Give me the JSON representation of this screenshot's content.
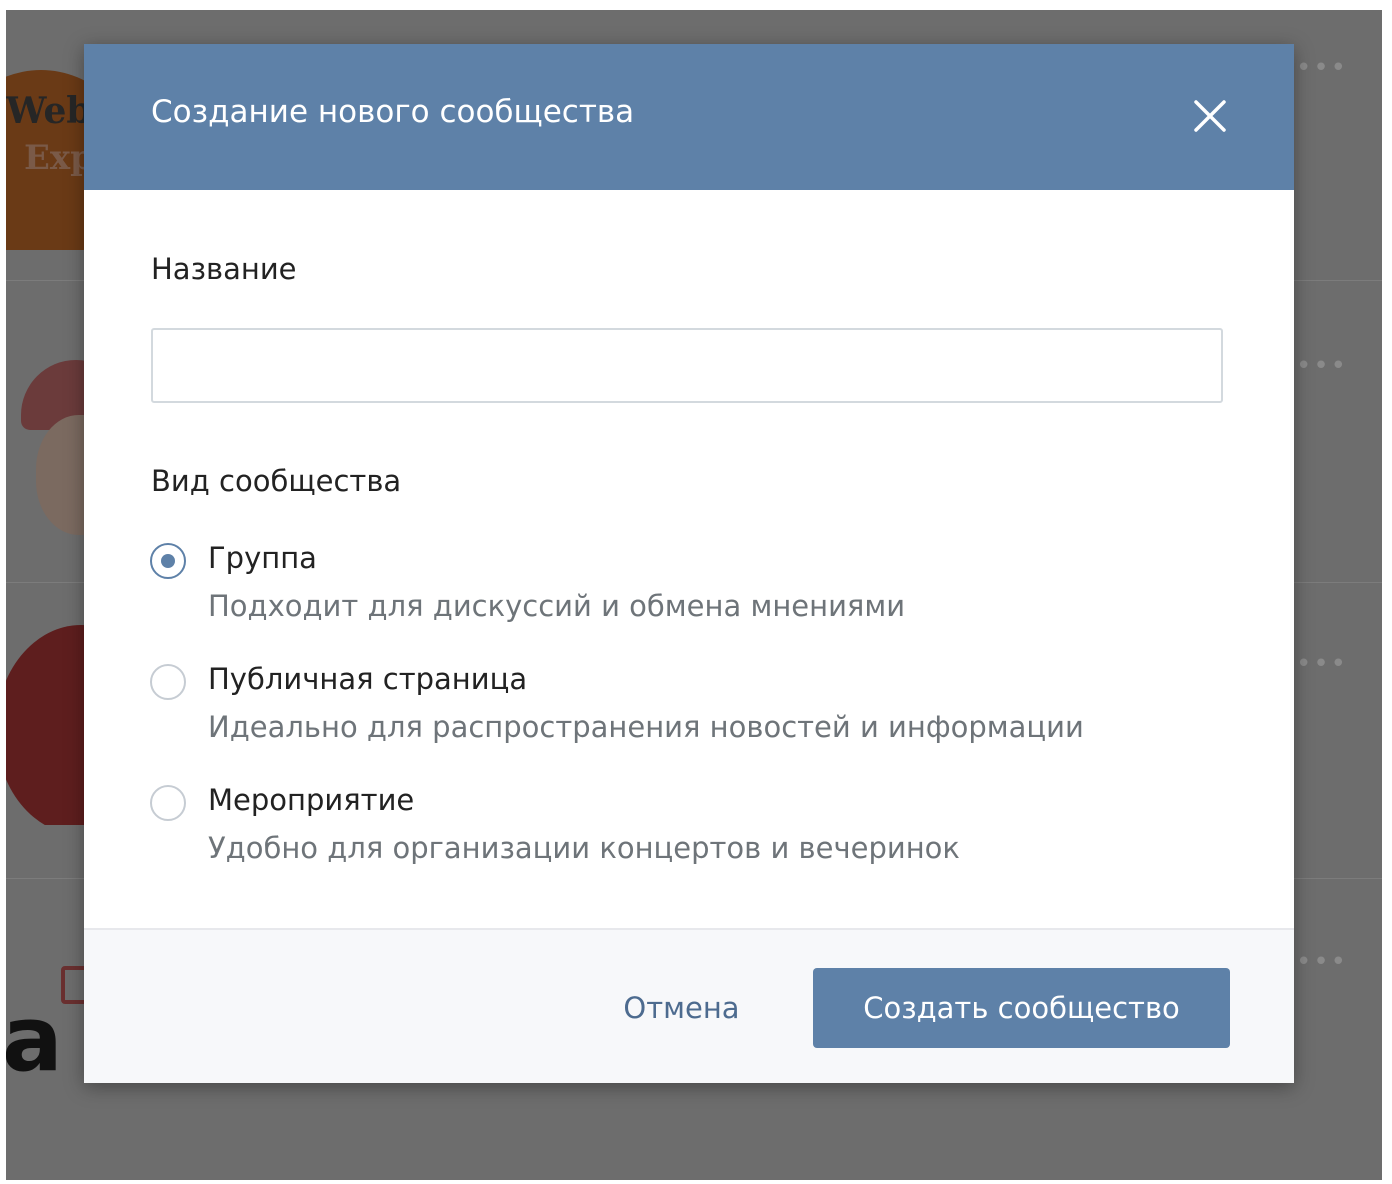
{
  "background": {
    "avatar_texts": {
      "webinar_line1": "WebI",
      "webinar_line2": "Exp",
      "bottom_logo": "a"
    }
  },
  "modal": {
    "title": "Создание нового сообщества",
    "close_icon": "close-icon",
    "name_label": "Название",
    "name_value": "",
    "type_label": "Вид сообщества",
    "options": [
      {
        "title": "Группа",
        "description": "Подходит для дискуссий и обмена мнениями",
        "selected": true
      },
      {
        "title": "Публичная страница",
        "description": "Идеально для распространения новостей и информации",
        "selected": false
      },
      {
        "title": "Мероприятие",
        "description": "Удобно для организации концертов и вечеринок",
        "selected": false
      }
    ],
    "cancel_label": "Отмена",
    "create_label": "Создать сообщество"
  },
  "colors": {
    "header": "#5e81a8",
    "primary_button": "#5e81a8",
    "cancel_text": "#4d6b8f",
    "backdrop": "#6d6d6d"
  }
}
